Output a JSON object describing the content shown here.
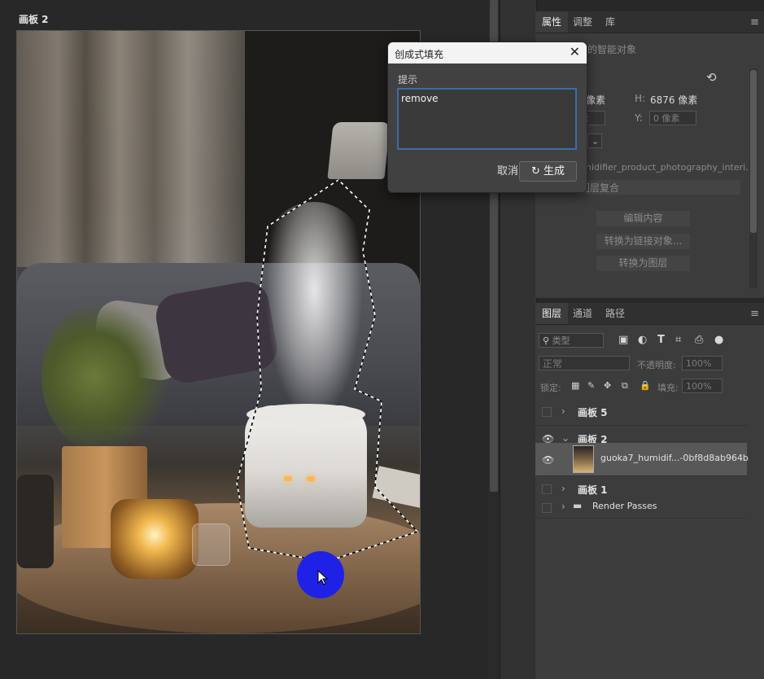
{
  "canvas": {
    "artboard_label": "画板 2"
  },
  "dialog": {
    "title": "创成式填充",
    "close_glyph": "✕",
    "prompt_label": "提示",
    "prompt_value": "remove",
    "cancel_label": "取消",
    "generate_icon": "↻",
    "generate_label": "生成"
  },
  "properties_panel": {
    "tabs": [
      "属性",
      "调整",
      "库"
    ],
    "active_tab": "属性",
    "subtitle_fragment": "的智能对象",
    "reset_icon": "⟲",
    "width_unit_fragment": "像素",
    "height_label": "H:",
    "height_value": "6876 像素",
    "x_fragment": "素",
    "y_label": "Y:",
    "y_placeholder": "0 像素",
    "filename_fragment": "nidifier_product_photography_interi...",
    "comp_fragment": "图层复合",
    "buttons": [
      "编辑内容",
      "转换为链接对象...",
      "转换为图层"
    ]
  },
  "layers_panel": {
    "tabs": [
      "图层",
      "通道",
      "路径"
    ],
    "active_tab": "图层",
    "filter_placeholder": "类型",
    "blend_mode": "正常",
    "opacity_label": "不透明度:",
    "opacity_value": "100%",
    "lock_label": "锁定:",
    "fill_label": "填充:",
    "fill_value": "100%",
    "layers": [
      {
        "name": "画板 5",
        "visible": false,
        "expanded": false
      },
      {
        "name": "画板 2",
        "visible": true,
        "expanded": true
      },
      {
        "name": "guoka7_humidif...-0bf8d8ab964b",
        "visible": true,
        "selected": true
      },
      {
        "name": "画板 1",
        "visible": false,
        "expanded": false
      },
      {
        "name": "Render Passes",
        "visible": false,
        "expanded": false
      }
    ]
  },
  "colors": {
    "accent_focus": "#3b6ea8",
    "cursor_highlight": "#1f22e6",
    "panel_bg": "#3c3c3c"
  }
}
